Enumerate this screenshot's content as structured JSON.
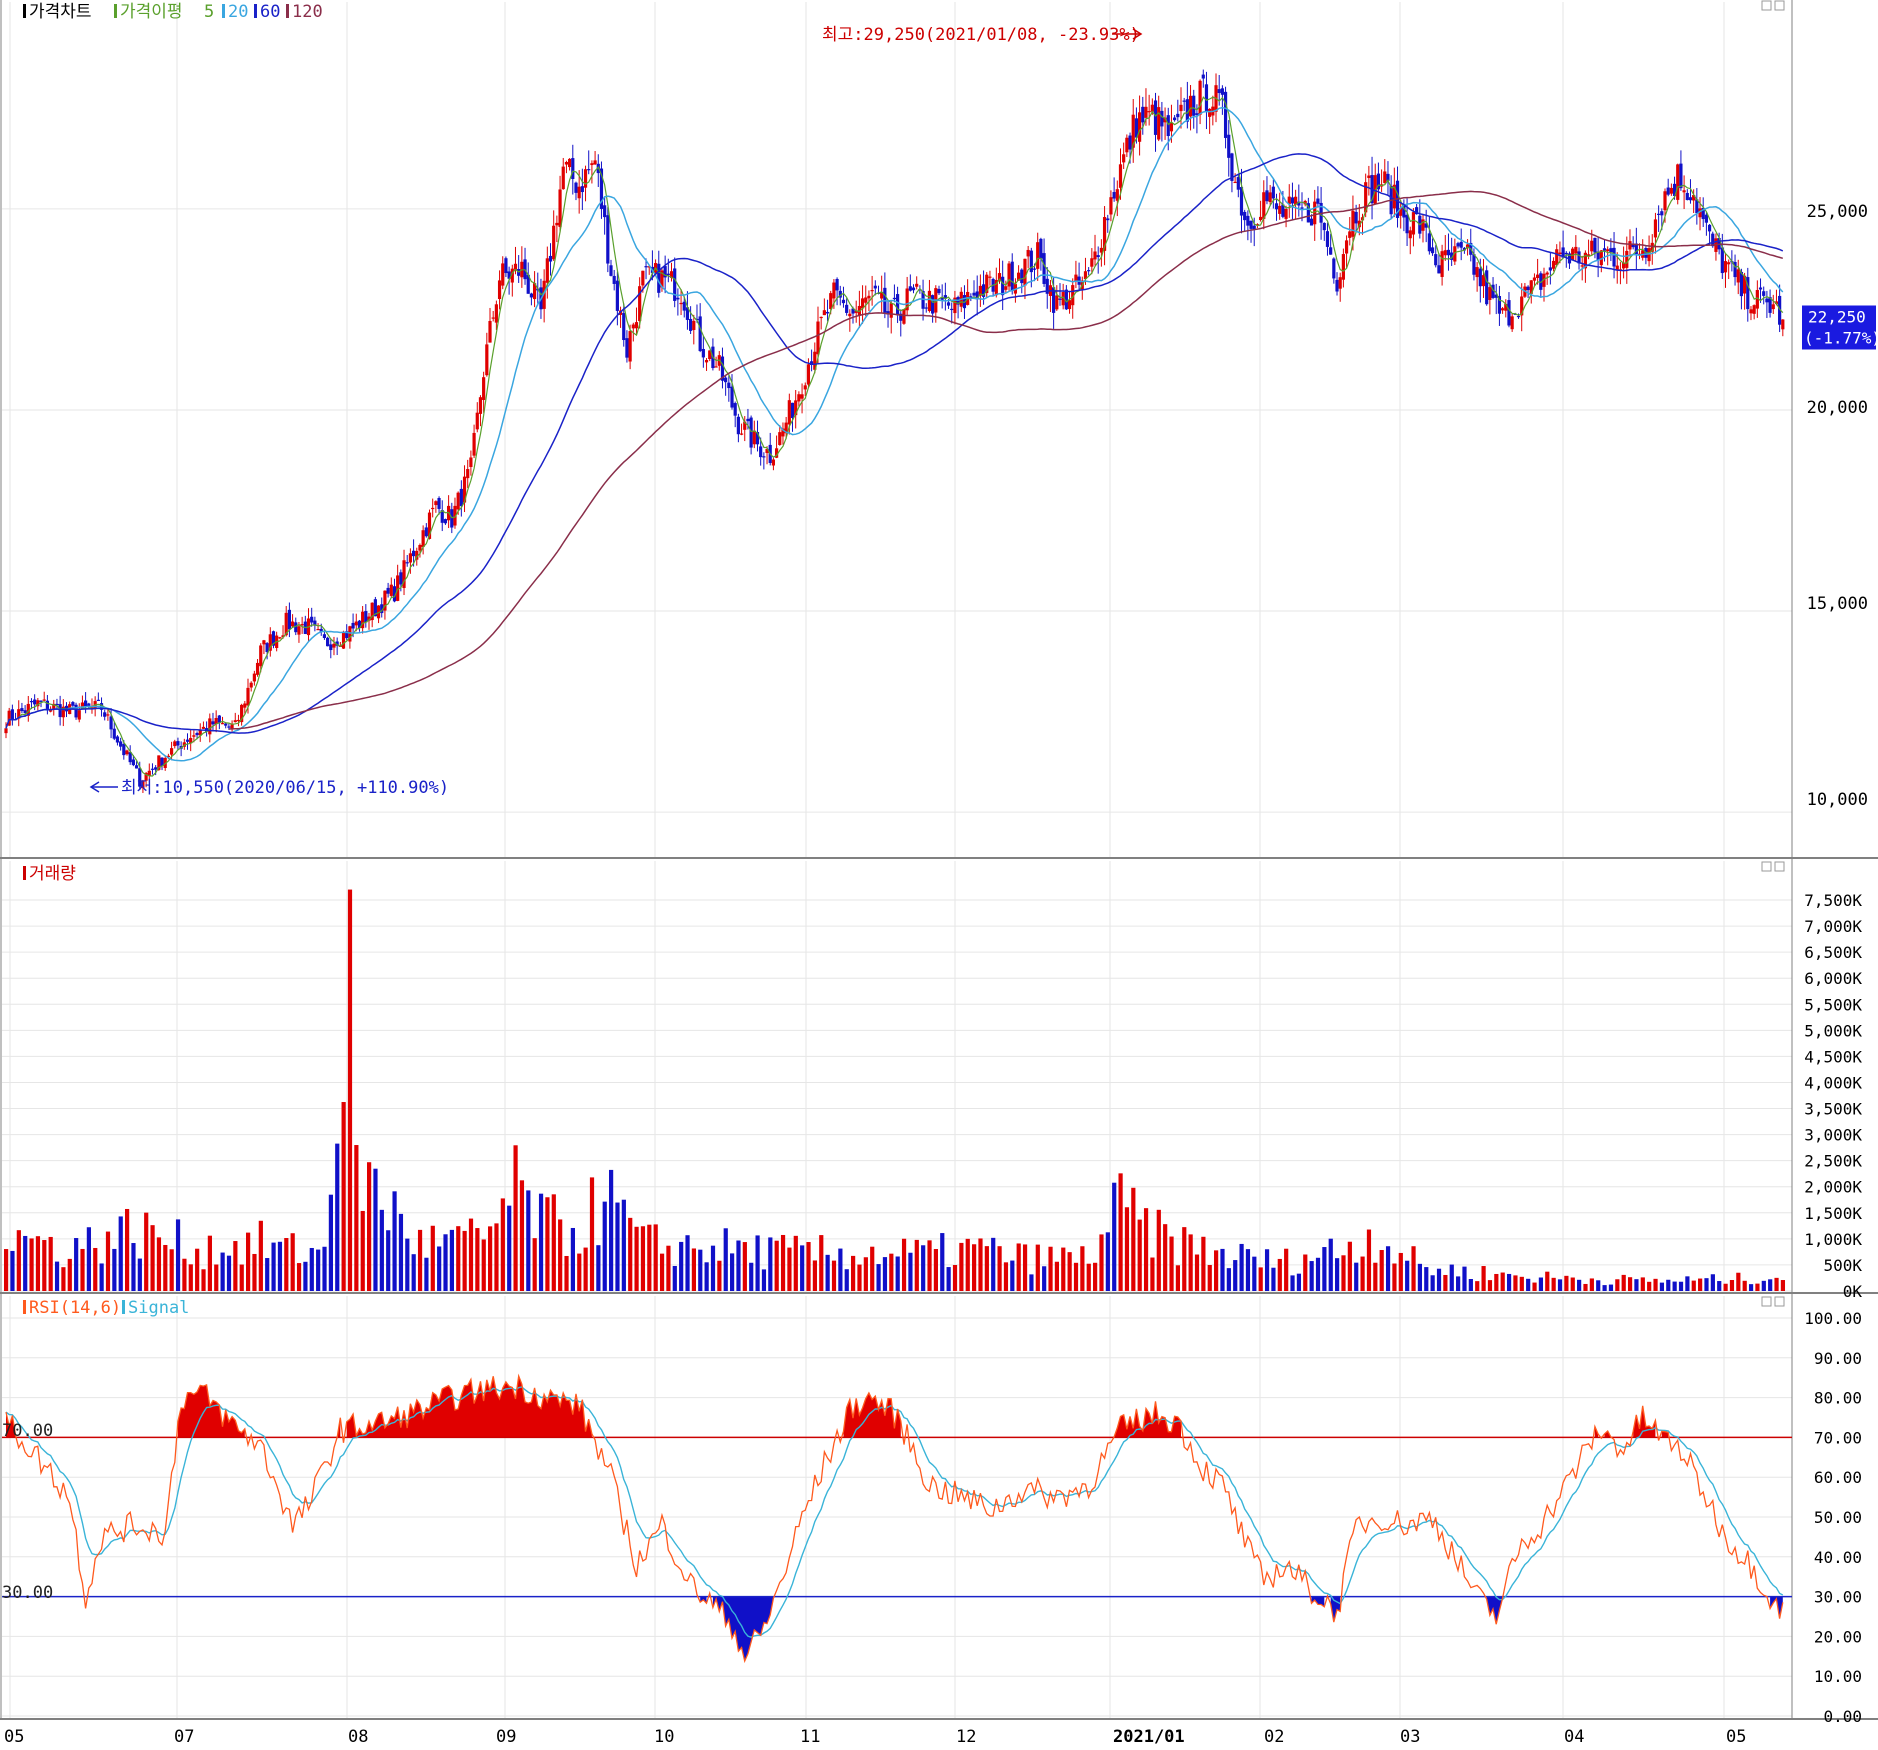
{
  "panels": {
    "price": {
      "title": "가격차트",
      "ma_label": "가격이평",
      "ma_periods": [
        "5",
        "20",
        "60",
        "120"
      ],
      "ma_colors": [
        "#5aa02c",
        "#3aa6e0",
        "#1a22c8",
        "#8a2e4a"
      ],
      "title_color": "#000000",
      "axis_labels": [
        "25,000",
        "20,000",
        "15,000",
        "10,000"
      ],
      "high_annotation": "최고:29,250(2021/01/08, -23.93%)",
      "low_annotation": "최저:10,550(2020/06/15, +110.90%)",
      "last_price": "22,250",
      "last_change": "(-1.77%)"
    },
    "volume": {
      "title": "거래량",
      "title_color": "#cc0000",
      "axis_labels": [
        "7,500K",
        "7,000K",
        "6,500K",
        "6,000K",
        "5,500K",
        "5,000K",
        "4,500K",
        "4,000K",
        "3,500K",
        "3,000K",
        "2,500K",
        "2,000K",
        "1,500K",
        "1,000K",
        "500K",
        "0K"
      ]
    },
    "rsi": {
      "title": "RSI(14,6)",
      "signal_label": "Signal",
      "rsi_color": "#ff5a1e",
      "signal_color": "#3ab4d8",
      "axis_labels": [
        "100.00",
        "90.00",
        "80.00",
        "70.00",
        "60.00",
        "50.00",
        "40.00",
        "30.00",
        "20.00",
        "10.00",
        "0.00"
      ],
      "upper_level_label": "70.00",
      "lower_level_label": "30.00"
    }
  },
  "x_axis_labels": [
    "05",
    "07",
    "08",
    "09",
    "10",
    "11",
    "12",
    "2021/01",
    "02",
    "03",
    "04",
    "05"
  ],
  "colors": {
    "up": "#e00000",
    "down": "#1010c8",
    "upper_level": "#cc0000",
    "lower_level": "#1a22c8",
    "grid": "#e6e6e6",
    "axis": "#808080"
  },
  "chart_data": {
    "type": "candlestick",
    "price_ylim": [
      8900,
      29900
    ],
    "volume_ylim": [
      0,
      7800000
    ],
    "rsi_ylim": [
      0,
      100
    ],
    "rsi_levels": [
      70,
      30
    ],
    "high": {
      "value": 29250,
      "date": "2021/01/08",
      "change_pct": -23.93
    },
    "low": {
      "value": 10550,
      "date": "2020/06/15",
      "change_pct": 110.9
    },
    "last": {
      "value": 22250,
      "change_pct": -1.77
    },
    "close_path": [
      [
        0,
        12300
      ],
      [
        10,
        12700
      ],
      [
        20,
        12500
      ],
      [
        30,
        12600
      ],
      [
        37,
        11500
      ],
      [
        42,
        10800
      ],
      [
        50,
        11400
      ],
      [
        58,
        11900
      ],
      [
        65,
        12200
      ],
      [
        72,
        12100
      ],
      [
        80,
        14000
      ],
      [
        88,
        14700
      ],
      [
        95,
        14600
      ],
      [
        100,
        14200
      ],
      [
        108,
        14500
      ],
      [
        115,
        15000
      ],
      [
        122,
        15500
      ],
      [
        128,
        16500
      ],
      [
        135,
        17600
      ],
      [
        140,
        17300
      ],
      [
        146,
        18500
      ],
      [
        150,
        21000
      ],
      [
        155,
        23300
      ],
      [
        162,
        23500
      ],
      [
        168,
        22400
      ],
      [
        175,
        26000
      ],
      [
        180,
        25600
      ],
      [
        185,
        26200
      ],
      [
        190,
        23500
      ],
      [
        195,
        21500
      ],
      [
        200,
        23200
      ],
      [
        205,
        23300
      ],
      [
        212,
        23000
      ],
      [
        218,
        21700
      ],
      [
        224,
        21000
      ],
      [
        230,
        19700
      ],
      [
        235,
        19200
      ],
      [
        240,
        18900
      ],
      [
        244,
        19500
      ],
      [
        248,
        20300
      ],
      [
        252,
        21200
      ],
      [
        256,
        22100
      ],
      [
        260,
        22800
      ],
      [
        266,
        22400
      ],
      [
        272,
        22800
      ],
      [
        278,
        22300
      ],
      [
        284,
        22800
      ],
      [
        292,
        22700
      ],
      [
        298,
        22500
      ],
      [
        305,
        23000
      ],
      [
        312,
        23100
      ],
      [
        318,
        23500
      ],
      [
        324,
        23800
      ],
      [
        330,
        22600
      ],
      [
        336,
        23000
      ],
      [
        340,
        23300
      ],
      [
        345,
        24700
      ],
      [
        350,
        26000
      ],
      [
        355,
        27200
      ],
      [
        360,
        27300
      ],
      [
        366,
        26800
      ],
      [
        372,
        27600
      ],
      [
        378,
        27900
      ],
      [
        382,
        27400
      ],
      [
        386,
        25700
      ],
      [
        390,
        24600
      ],
      [
        395,
        25300
      ],
      [
        400,
        24900
      ],
      [
        406,
        24900
      ],
      [
        412,
        25000
      ],
      [
        418,
        23300
      ],
      [
        422,
        24700
      ],
      [
        428,
        25500
      ],
      [
        432,
        25700
      ],
      [
        438,
        24900
      ],
      [
        444,
        24600
      ],
      [
        450,
        23600
      ],
      [
        456,
        23800
      ],
      [
        460,
        23700
      ],
      [
        465,
        22900
      ],
      [
        470,
        22300
      ],
      [
        475,
        22700
      ],
      [
        480,
        23000
      ],
      [
        488,
        23900
      ],
      [
        495,
        23800
      ],
      [
        502,
        23900
      ],
      [
        508,
        23800
      ],
      [
        515,
        24100
      ],
      [
        520,
        25200
      ],
      [
        525,
        25800
      ],
      [
        530,
        25400
      ],
      [
        535,
        24200
      ],
      [
        540,
        23600
      ],
      [
        545,
        23000
      ],
      [
        550,
        22700
      ],
      [
        555,
        22600
      ],
      [
        558,
        22250
      ]
    ],
    "volume_path": [
      [
        0,
        1200
      ],
      [
        20,
        900
      ],
      [
        40,
        1300
      ],
      [
        60,
        900
      ],
      [
        80,
        1000
      ],
      [
        95,
        800
      ],
      [
        100,
        900
      ],
      [
        108,
        7700
      ],
      [
        112,
        2500
      ],
      [
        120,
        1800
      ],
      [
        130,
        1000
      ],
      [
        150,
        1100
      ],
      [
        160,
        2100
      ],
      [
        170,
        1400
      ],
      [
        180,
        1300
      ],
      [
        188,
        2000
      ],
      [
        200,
        1000
      ],
      [
        230,
        900
      ],
      [
        250,
        800
      ],
      [
        270,
        800
      ],
      [
        290,
        800
      ],
      [
        305,
        900
      ],
      [
        320,
        700
      ],
      [
        340,
        700
      ],
      [
        350,
        1800
      ],
      [
        360,
        1200
      ],
      [
        380,
        800
      ],
      [
        400,
        600
      ],
      [
        420,
        900
      ],
      [
        430,
        1200
      ],
      [
        445,
        500
      ],
      [
        460,
        400
      ],
      [
        480,
        300
      ],
      [
        500,
        250
      ],
      [
        520,
        220
      ],
      [
        540,
        250
      ],
      [
        558,
        300
      ]
    ],
    "rsi_path": [
      [
        0,
        74
      ],
      [
        10,
        65
      ],
      [
        20,
        55
      ],
      [
        25,
        30
      ],
      [
        30,
        45
      ],
      [
        40,
        48
      ],
      [
        50,
        46
      ],
      [
        55,
        80
      ],
      [
        62,
        81
      ],
      [
        70,
        74
      ],
      [
        80,
        68
      ],
      [
        90,
        48
      ],
      [
        95,
        53
      ],
      [
        105,
        72
      ],
      [
        120,
        74
      ],
      [
        130,
        77
      ],
      [
        140,
        80
      ],
      [
        150,
        82
      ],
      [
        160,
        83
      ],
      [
        170,
        80
      ],
      [
        180,
        78
      ],
      [
        190,
        60
      ],
      [
        198,
        38
      ],
      [
        206,
        48
      ],
      [
        215,
        33
      ],
      [
        222,
        28
      ],
      [
        228,
        23
      ],
      [
        232,
        15
      ],
      [
        238,
        22
      ],
      [
        244,
        35
      ],
      [
        250,
        50
      ],
      [
        258,
        65
      ],
      [
        266,
        78
      ],
      [
        272,
        80
      ],
      [
        280,
        75
      ],
      [
        290,
        58
      ],
      [
        300,
        55
      ],
      [
        310,
        52
      ],
      [
        320,
        57
      ],
      [
        330,
        55
      ],
      [
        340,
        58
      ],
      [
        350,
        72
      ],
      [
        360,
        76
      ],
      [
        368,
        74
      ],
      [
        375,
        63
      ],
      [
        382,
        58
      ],
      [
        390,
        42
      ],
      [
        395,
        34
      ],
      [
        402,
        38
      ],
      [
        412,
        30
      ],
      [
        418,
        26
      ],
      [
        424,
        48
      ],
      [
        432,
        50
      ],
      [
        440,
        48
      ],
      [
        448,
        50
      ],
      [
        455,
        40
      ],
      [
        462,
        30
      ],
      [
        468,
        25
      ],
      [
        475,
        42
      ],
      [
        482,
        48
      ],
      [
        490,
        58
      ],
      [
        500,
        72
      ],
      [
        508,
        67
      ],
      [
        514,
        75
      ],
      [
        520,
        70
      ],
      [
        526,
        67
      ],
      [
        532,
        58
      ],
      [
        540,
        45
      ],
      [
        548,
        38
      ],
      [
        554,
        30
      ],
      [
        558,
        26
      ]
    ]
  }
}
